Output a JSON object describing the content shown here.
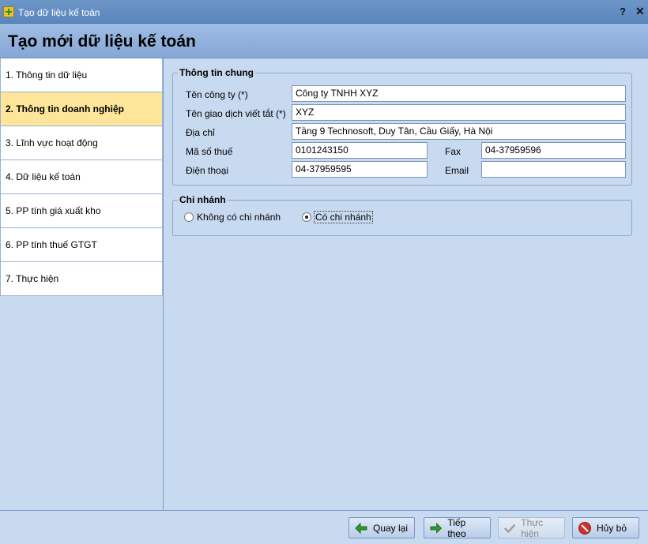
{
  "window": {
    "title": "Tạo dữ liệu kế toán",
    "help": "?",
    "close": "✕"
  },
  "header": {
    "title": "Tạo mới dữ liệu kế toán"
  },
  "steps": [
    {
      "label": "1. Thông tin dữ liệu"
    },
    {
      "label": "2. Thông tin doanh nghiệp",
      "active": true
    },
    {
      "label": "3. Lĩnh vực hoạt động"
    },
    {
      "label": "4. Dữ liệu kế toán"
    },
    {
      "label": "5. PP tính giá xuất kho"
    },
    {
      "label": "6. PP tính thuế GTGT"
    },
    {
      "label": "7. Thực hiện"
    }
  ],
  "general": {
    "legend": "Thông tin chung",
    "company_name_label": "Tên công ty (*)",
    "company_name_value": "Công ty TNHH XYZ",
    "short_name_label": "Tên giao dịch viết tắt (*)",
    "short_name_value": "XYZ",
    "address_label": "Địa chỉ",
    "address_value": "Tầng 9 Technosoft, Duy Tân, Cầu Giấy, Hà Nội",
    "tax_code_label": "Mã số thuế",
    "tax_code_value": "0101243150",
    "fax_label": "Fax",
    "fax_value": "04-37959596",
    "phone_label": "Điện thoại",
    "phone_value": "04-37959595",
    "email_label": "Email",
    "email_value": ""
  },
  "branch": {
    "legend": "Chi nhánh",
    "no_branch": "Không có chi nhánh",
    "has_branch": "Có chi nhánh",
    "selected": "has_branch"
  },
  "footer": {
    "back": "Quay lại",
    "next": "Tiếp theo",
    "execute": "Thực hiện",
    "cancel": "Hủy bỏ"
  },
  "colors": {
    "active_step": "#fde59a",
    "back_icon": "#2f9a2f",
    "cancel_icon": "#d23030"
  }
}
